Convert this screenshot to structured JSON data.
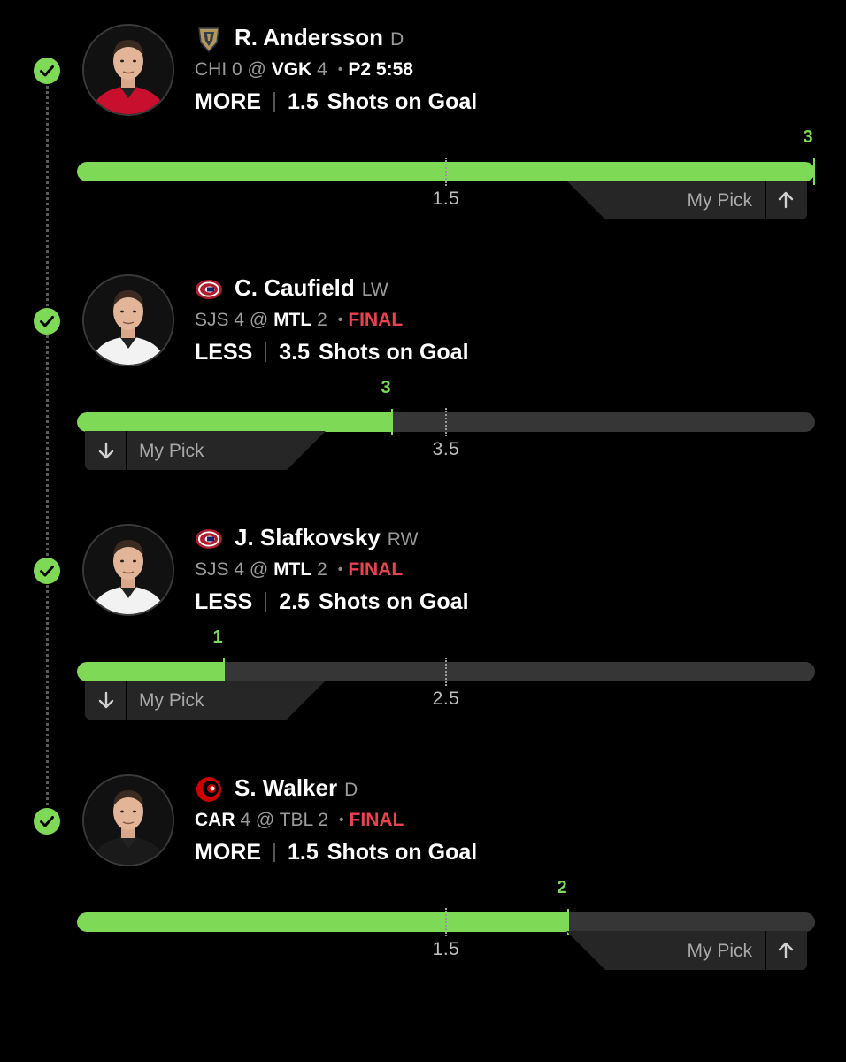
{
  "colors": {
    "background": "#000000",
    "accent_green": "#7ed957",
    "final_red": "#e8434f",
    "track": "#363636",
    "muted_text": "#9a9a9a"
  },
  "picks": [
    {
      "player_name": "R. Andersson",
      "position": "D",
      "team_logo": "vegas-golden-knights-logo",
      "away_team": "CHI",
      "away_score": "0",
      "at": "@",
      "home_team": "VGK",
      "home_score": "4",
      "bold_team": "home",
      "status": "P2 5:58",
      "status_type": "live",
      "direction": "MORE",
      "line": "1.5",
      "line_value": 1.5,
      "stat": "Shots on Goal",
      "result": "3",
      "result_value": 3,
      "scale_max": 3.0,
      "my_pick_label": "My Pick",
      "pick_icon": "arrow-up-icon",
      "jersey_color": "#c8102e"
    },
    {
      "player_name": "C. Caufield",
      "position": "LW",
      "team_logo": "montreal-canadiens-logo",
      "away_team": "SJS",
      "away_score": "4",
      "at": "@",
      "home_team": "MTL",
      "home_score": "2",
      "bold_team": "home",
      "status": "FINAL",
      "status_type": "final",
      "direction": "LESS",
      "line": "3.5",
      "line_value": 3.5,
      "stat": "Shots on Goal",
      "result": "3",
      "result_value": 3,
      "scale_max": 7.0,
      "my_pick_label": "My Pick",
      "pick_icon": "arrow-down-icon",
      "jersey_color": "#f2f2f2"
    },
    {
      "player_name": "J. Slafkovsky",
      "position": "RW",
      "team_logo": "montreal-canadiens-logo",
      "away_team": "SJS",
      "away_score": "4",
      "at": "@",
      "home_team": "MTL",
      "home_score": "2",
      "bold_team": "home",
      "status": "FINAL",
      "status_type": "final",
      "direction": "LESS",
      "line": "2.5",
      "line_value": 2.5,
      "stat": "Shots on Goal",
      "result": "1",
      "result_value": 1,
      "scale_max": 5.0,
      "my_pick_label": "My Pick",
      "pick_icon": "arrow-down-icon",
      "jersey_color": "#f2f2f2"
    },
    {
      "player_name": "S. Walker",
      "position": "D",
      "team_logo": "carolina-hurricanes-logo",
      "away_team": "CAR",
      "away_score": "4",
      "at": "@",
      "home_team": "TBL",
      "home_score": "2",
      "bold_team": "away",
      "status": "FINAL",
      "status_type": "final",
      "direction": "MORE",
      "line": "1.5",
      "line_value": 1.5,
      "stat": "Shots on Goal",
      "result": "2",
      "result_value": 2,
      "scale_max": 3.0,
      "my_pick_label": "My Pick",
      "pick_icon": "arrow-up-icon",
      "jersey_color": "#1a1a1a"
    }
  ]
}
